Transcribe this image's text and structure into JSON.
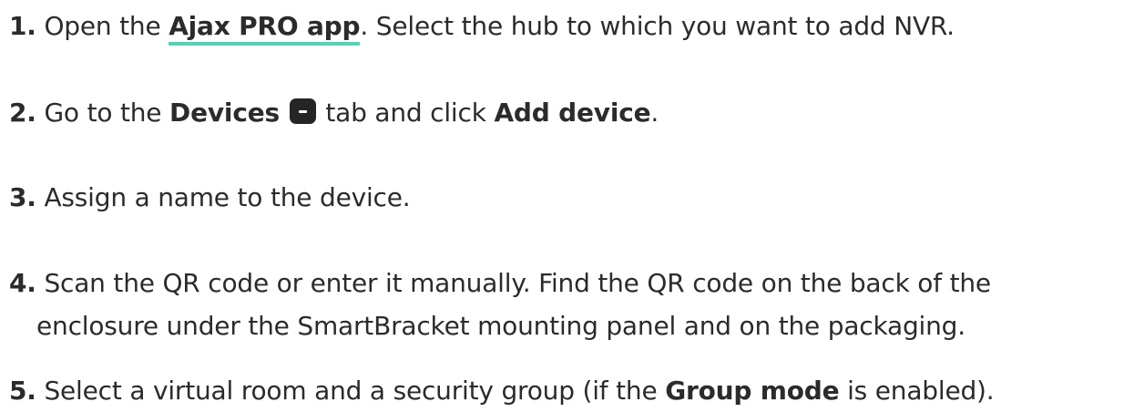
{
  "steps": [
    {
      "num": "1.",
      "t1": "Open the ",
      "link": "Ajax PRO app",
      "t2": ". Select the hub to which you want to add NVR."
    },
    {
      "num": "2.",
      "t1": "Go to the ",
      "b1": "Devices",
      "icon": "devices-tab-icon",
      "t2": " tab and click ",
      "b2": "Add device",
      "t3": "."
    },
    {
      "num": "3.",
      "t1": "Assign a name to the device."
    },
    {
      "num": "4.",
      "line1": "Scan the QR code or enter it manually. Find the QR code on the back of the",
      "line2": "enclosure under the SmartBracket mounting panel and on the packaging."
    },
    {
      "num": "5.",
      "t1": "Select a virtual room and a security group (if the ",
      "b1": "Group mode",
      "t2": " is enabled)."
    }
  ],
  "colors": {
    "text": "#2b2b2b",
    "link_underline": "#4fd6b4",
    "icon_bg": "#252525"
  }
}
